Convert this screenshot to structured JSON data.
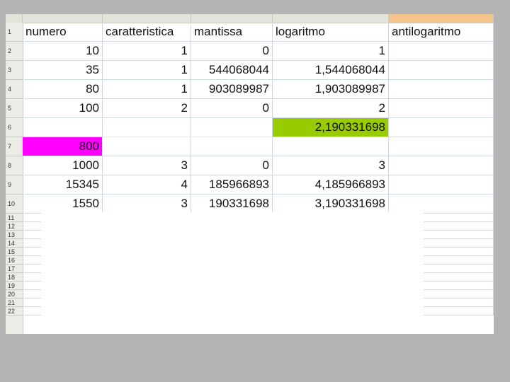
{
  "colors": {
    "highlight_green": "#99cc00",
    "highlight_magenta": "#ff00ff",
    "frame": "#b4b4b4"
  },
  "headers": [
    "numero",
    "caratteristica",
    "mantissa",
    "logaritmo",
    "antilogaritmo"
  ],
  "row_numbers": [
    "1",
    "2",
    "3",
    "4",
    "5",
    "6",
    "7",
    "8",
    "9",
    "10",
    "11",
    "12",
    "13",
    "14",
    "15",
    "16",
    "17",
    "18",
    "19",
    "20",
    "21",
    "22"
  ],
  "rows": [
    [
      "10",
      "1",
      "0",
      "1",
      ""
    ],
    [
      "35",
      "1",
      "544068044",
      "1,544068044",
      ""
    ],
    [
      "80",
      "1",
      "903089987",
      "1,903089987",
      ""
    ],
    [
      "100",
      "2",
      "0",
      "2",
      ""
    ],
    [
      "",
      "",
      "",
      "2,190331698",
      ""
    ],
    [
      "800",
      "",
      "",
      "",
      ""
    ],
    [
      "1000",
      "3",
      "0",
      "3",
      ""
    ],
    [
      "15345",
      "4",
      "185966893",
      "4,185966893",
      ""
    ],
    [
      "1550",
      "3",
      "190331698",
      "3,190331698",
      ""
    ]
  ]
}
